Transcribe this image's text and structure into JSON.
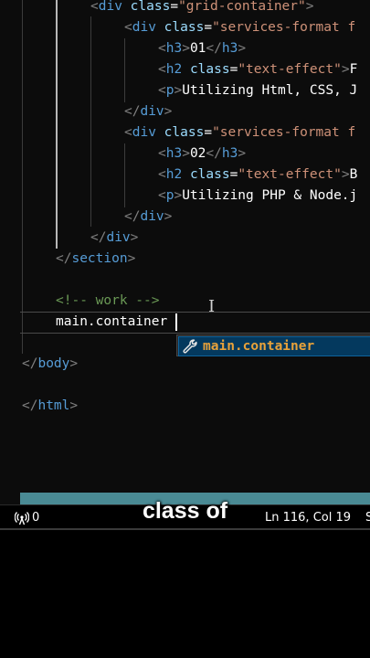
{
  "editor": {
    "lines": [
      {
        "open_div": "div",
        "class_attr": "class",
        "eq": "=",
        "class_val": "\"grid-container\""
      },
      {
        "open_div": "div",
        "class_attr": "class",
        "eq": "=",
        "class_val": "\"services-format f"
      },
      {
        "tag": "h3",
        "text": "01"
      },
      {
        "tag": "h2",
        "class_attr": "class",
        "class_val": "\"text-effect\"",
        "text": "F"
      },
      {
        "tag": "p",
        "text": "Utilizing Html, CSS, J"
      },
      {
        "close": "div"
      },
      {
        "open_div": "div",
        "class_attr": "class",
        "eq": "=",
        "class_val": "\"services-format f"
      },
      {
        "tag": "h3",
        "text": "02"
      },
      {
        "tag": "h2",
        "class_attr": "class",
        "class_val": "\"text-effect\"",
        "text": "B"
      },
      {
        "tag": "p",
        "text": "Utilizing PHP & Node.j"
      },
      {
        "close": "div"
      },
      {
        "close": "div"
      },
      {
        "close": "section"
      },
      {
        "comment": "<!-- work -->"
      },
      {
        "typed": "main.container"
      },
      {
        "close": "body"
      },
      {
        "close": "html"
      }
    ]
  },
  "suggestion": {
    "label": "main.container",
    "icon": "wrench-icon"
  },
  "status_bar": {
    "ports": "0",
    "position": "Ln 116, Col 19",
    "trailing": "S"
  },
  "caption": "class of"
}
